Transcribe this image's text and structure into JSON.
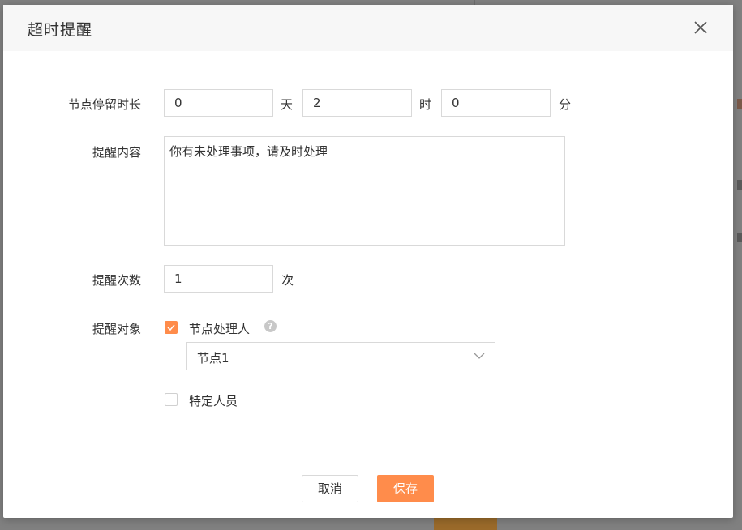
{
  "dialog": {
    "title": "超时提醒",
    "close_icon": "close-icon"
  },
  "duration": {
    "label": "节点停留时长",
    "days_value": "0",
    "days_unit": "天",
    "hours_value": "2",
    "hours_unit": "时",
    "minutes_value": "0",
    "minutes_unit": "分"
  },
  "content": {
    "label": "提醒内容",
    "value": "你有未处理事项，请及时处理"
  },
  "count": {
    "label": "提醒次数",
    "value": "1",
    "unit": "次"
  },
  "target": {
    "label": "提醒对象",
    "node_handler": {
      "label": "节点处理人",
      "checked": true,
      "help_icon": "question-icon",
      "select_value": "节点1"
    },
    "specific_person": {
      "label": "特定人员",
      "checked": false
    }
  },
  "footer": {
    "cancel_label": "取消",
    "save_label": "保存"
  },
  "colors": {
    "accent": "#ff8c4b",
    "header_bg": "#f7f7f7",
    "border": "#d9d9d9"
  }
}
